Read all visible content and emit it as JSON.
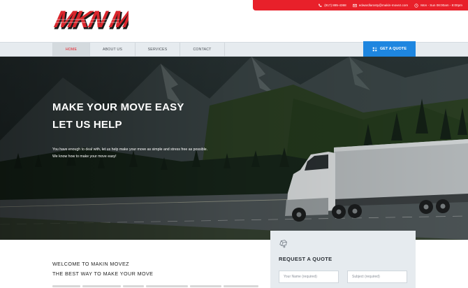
{
  "contact_bar": {
    "phone": "(817) 885-4368",
    "email": "edwardlarosty@makin-movez.com",
    "hours": "Mon - Sun 08:00am - 8:00pm",
    "icons": [
      "phone-icon",
      "email-icon",
      "clock-icon"
    ]
  },
  "logo": {
    "text": "MKN MVZ",
    "color": "#d9262c"
  },
  "nav": {
    "items": [
      {
        "label": "HOME",
        "active": true
      },
      {
        "label": "ABOUT US",
        "active": false
      },
      {
        "label": "SERVICES",
        "active": false
      },
      {
        "label": "CONTACT",
        "active": false
      }
    ],
    "quote_button": "GET A QUOTE",
    "quote_icon": "calculator-icon"
  },
  "hero": {
    "title_line1": "MAKE YOUR MOVE EASY",
    "title_line2": "LET US HELP",
    "text_line1": "You have enough to deal with, let us help make your move as simple and stress free as possible.",
    "text_line2": "We know how to make your move easy!"
  },
  "welcome": {
    "heading": "WELCOME TO MAKIN MOVEZ",
    "subheading": "THE BEST WAY TO MAKE YOUR MOVE"
  },
  "quote_form": {
    "title": "REQUEST A QUOTE",
    "icon": "truck-sketch-icon",
    "name_placeholder": "Your Name (required)",
    "subject_placeholder": "Subject (required)"
  },
  "colors": {
    "accent_red": "#e8202a",
    "accent_blue": "#1e86e0",
    "nav_bg": "#e6ebef"
  }
}
